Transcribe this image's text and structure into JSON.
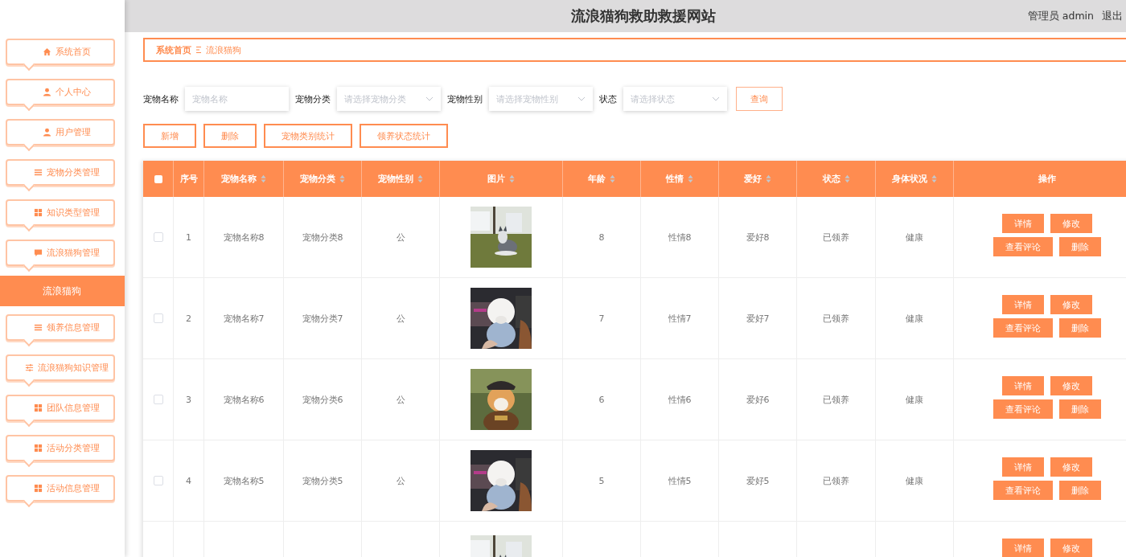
{
  "header": {
    "title": "流浪猫狗救助救援网站",
    "user": "管理员 admin",
    "logout": "退出"
  },
  "sidebar": {
    "items": [
      {
        "label": "系统首页",
        "kind": "home",
        "selected": false
      },
      {
        "label": "个人中心",
        "kind": "user",
        "selected": false
      },
      {
        "label": "用户管理",
        "kind": "user",
        "selected": false
      },
      {
        "label": "宠物分类管理",
        "kind": "list",
        "selected": false
      },
      {
        "label": "知识类型管理",
        "kind": "grid",
        "selected": false
      },
      {
        "label": "流浪猫狗管理",
        "kind": "chat",
        "selected": false
      },
      {
        "label": "流浪猫狗",
        "kind": "plain",
        "selected": true
      },
      {
        "label": "领养信息管理",
        "kind": "list",
        "selected": false
      },
      {
        "label": "流浪猫狗知识管理",
        "kind": "sliders",
        "selected": false
      },
      {
        "label": "团队信息管理",
        "kind": "grid",
        "selected": false
      },
      {
        "label": "活动分类管理",
        "kind": "grid",
        "selected": false
      },
      {
        "label": "活动信息管理",
        "kind": "grid",
        "selected": false
      }
    ]
  },
  "breadcrumb": [
    "系统首页",
    "流浪猫狗"
  ],
  "filters": [
    {
      "label": "宠物名称",
      "kind": "input",
      "placeholder": "宠物名称"
    },
    {
      "label": "宠物分类",
      "kind": "select",
      "placeholder": "请选择宠物分类"
    },
    {
      "label": "宠物性别",
      "kind": "select",
      "placeholder": "请选择宠物性别"
    },
    {
      "label": "状态",
      "kind": "select",
      "placeholder": "请选择状态"
    }
  ],
  "search_button": "查询",
  "actions": [
    "新增",
    "删除",
    "宠物类别统计",
    "领养状态统计"
  ],
  "table": {
    "select_all": false,
    "columns": [
      {
        "label": "序号",
        "kind": "plain"
      },
      {
        "label": "宠物名称",
        "kind": "sort"
      },
      {
        "label": "宠物分类",
        "kind": "sort"
      },
      {
        "label": "宠物性别",
        "kind": "sort"
      },
      {
        "label": "图片",
        "kind": "sort"
      },
      {
        "label": "年龄",
        "kind": "sort"
      },
      {
        "label": "性情",
        "kind": "sort"
      },
      {
        "label": "爱好",
        "kind": "sort"
      },
      {
        "label": "状态",
        "kind": "sort"
      },
      {
        "label": "身体状况",
        "kind": "sort"
      },
      {
        "label": "操作",
        "kind": "plain"
      }
    ],
    "rows": [
      {
        "selected": false,
        "cells": [
          "1",
          "宠物名称8",
          "宠物分类8",
          "公",
          "",
          "8",
          "性情8",
          "爱好8",
          "已领养",
          "健康"
        ],
        "buttons": [
          "详情",
          "修改",
          "查看评论",
          "删除"
        ]
      },
      {
        "selected": false,
        "cells": [
          "2",
          "宠物名称7",
          "宠物分类7",
          "公",
          "",
          "7",
          "性情7",
          "爱好7",
          "已领养",
          "健康"
        ],
        "buttons": [
          "详情",
          "修改",
          "查看评论",
          "删除"
        ]
      },
      {
        "selected": false,
        "cells": [
          "3",
          "宠物名称6",
          "宠物分类6",
          "公",
          "",
          "6",
          "性情6",
          "爱好6",
          "已领养",
          "健康"
        ],
        "buttons": [
          "详情",
          "修改",
          "查看评论",
          "删除"
        ]
      },
      {
        "selected": false,
        "cells": [
          "4",
          "宠物名称5",
          "宠物分类5",
          "公",
          "",
          "5",
          "性情5",
          "爱好5",
          "已领养",
          "健康"
        ],
        "buttons": [
          "详情",
          "修改",
          "查看评论",
          "删除"
        ]
      },
      {
        "cells": [],
        "buttons": [
          "详情",
          "修改"
        ]
      }
    ]
  }
}
